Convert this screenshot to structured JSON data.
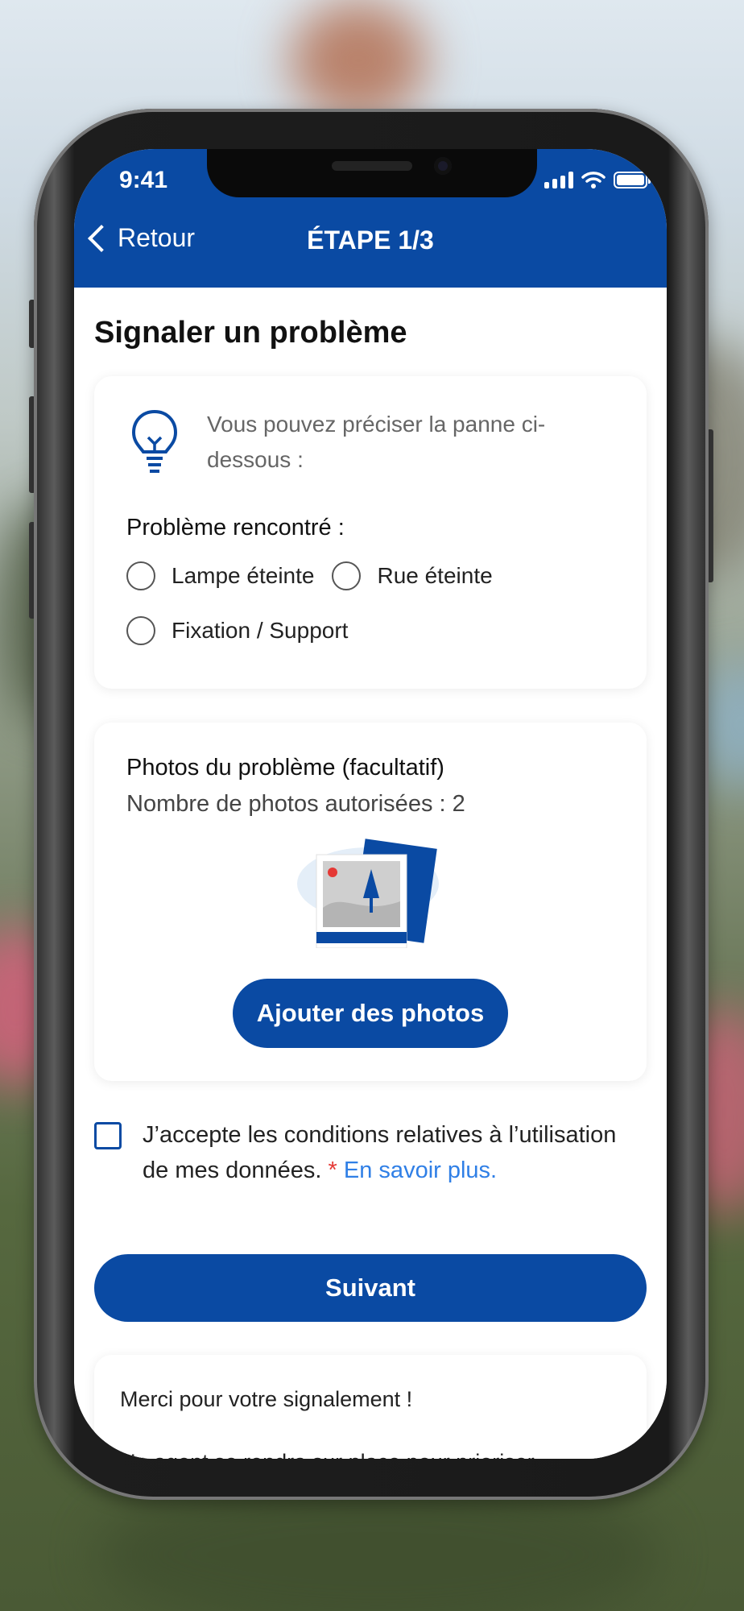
{
  "status": {
    "time": "9:41"
  },
  "header": {
    "back_label": "Retour",
    "step_title": "ÉTAPE 1/3"
  },
  "page": {
    "title": "Signaler un problème"
  },
  "problem_card": {
    "hint": "Vous pouvez préciser la panne ci-dessous :",
    "label": "Problème rencontré :",
    "options": [
      "Lampe éteinte",
      "Rue éteinte",
      "Fixation / Support"
    ]
  },
  "photo_card": {
    "title": "Photos du problème (facultatif)",
    "subtitle": "Nombre de photos autorisées : 2",
    "button_label": "Ajouter des photos"
  },
  "consent": {
    "text": "J’accepte les conditions relatives à l’utilisation de mes données.",
    "required_mark": "*",
    "link_label": "En savoir plus."
  },
  "next_button_label": "Suivant",
  "info_card": {
    "line1": "Merci pour votre signalement !",
    "line2": "Un agent se rendra sur place pour prioriser"
  },
  "colors": {
    "primary": "#0a4aa3",
    "link": "#2f7fe6",
    "required": "#e53935"
  },
  "icons": [
    "chevron-left-icon",
    "signal-icon",
    "wifi-icon",
    "battery-icon",
    "lightbulb-icon",
    "photo-illustration"
  ]
}
